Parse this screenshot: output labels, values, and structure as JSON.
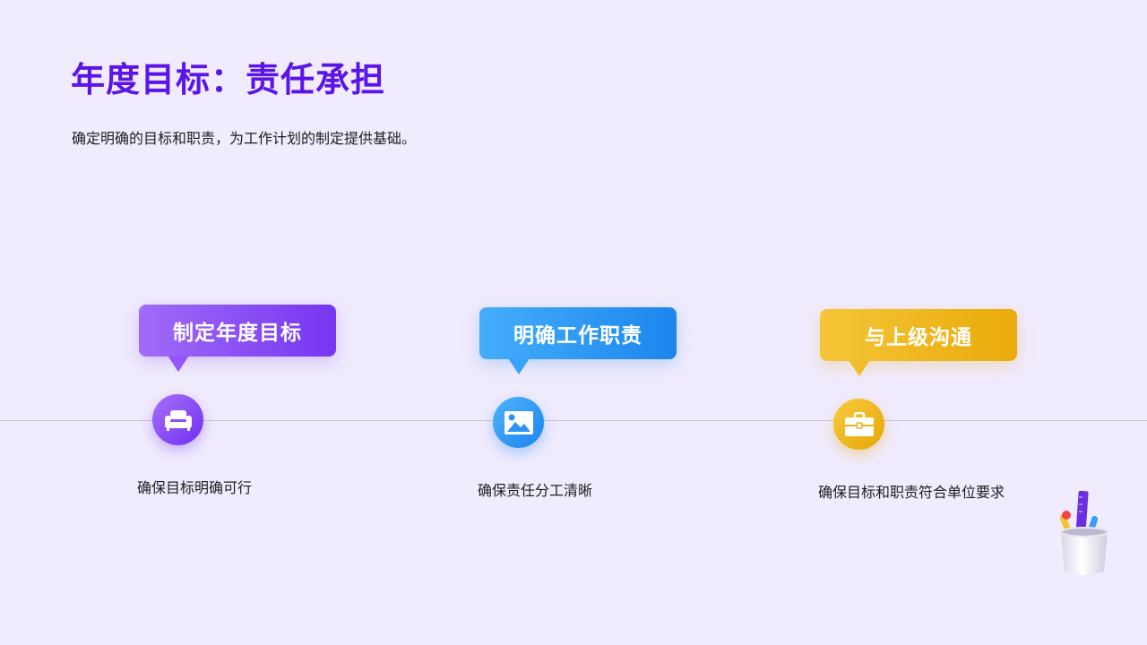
{
  "slide": {
    "title": "年度目标：责任承担",
    "subtitle": "确定明确的目标和职责，为工作计划的制定提供基础。"
  },
  "steps": [
    {
      "label": "制定年度目标",
      "description": "确保目标明确可行",
      "icon": "sofa-icon",
      "color": "#7f42f4"
    },
    {
      "label": "明确工作职责",
      "description": "确保责任分工清晰",
      "icon": "image-icon",
      "color": "#2a93f2"
    },
    {
      "label": "与上级沟通",
      "description": "确保目标和职责符合单位要求",
      "icon": "briefcase-icon",
      "color": "#edb21a"
    }
  ],
  "colors": {
    "background": "#f0ebfd",
    "title": "#5b15e8",
    "timeline": "#c8c3dc"
  },
  "decoration": {
    "icon": "pencil-cup-icon"
  }
}
